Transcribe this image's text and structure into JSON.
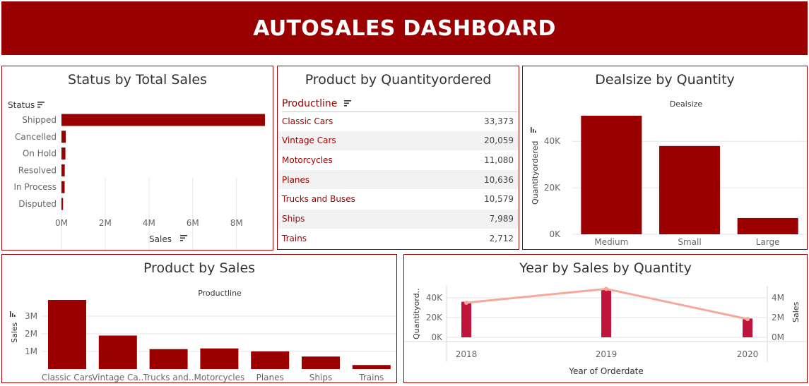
{
  "header": {
    "title": "AUTOSALES DASHBOARD"
  },
  "colors": {
    "brand": "#9a0000",
    "bar": "#9a0000",
    "sales_bar": "#c0143c",
    "line": "#f4a99a",
    "grid": "#e6e6e6"
  },
  "status_panel": {
    "title": "Status by Total Sales",
    "row_header": "Status",
    "axis_label": "Sales",
    "sort_icon": "sort-descending-icon",
    "chart_data": {
      "type": "bar",
      "orientation": "horizontal",
      "categories": [
        "Shipped",
        "Cancelled",
        "On Hold",
        "Resolved",
        "In Process",
        "Disputed"
      ],
      "values": [
        9300000,
        195000,
        180000,
        150000,
        145000,
        72000
      ],
      "xlim": [
        0,
        9300000
      ],
      "ticks": [
        0,
        2000000,
        4000000,
        6000000,
        8000000
      ],
      "tick_labels": [
        "0M",
        "2M",
        "4M",
        "6M",
        "8M"
      ],
      "grid": true
    }
  },
  "quantity_panel": {
    "title": "Product by Quantityordered",
    "row_header": "Productline",
    "sort_icon": "sort-descending-icon",
    "chart_data": {
      "type": "table",
      "rows": [
        {
          "name": "Classic Cars",
          "value": "33,373"
        },
        {
          "name": "Vintage Cars",
          "value": "20,059"
        },
        {
          "name": "Motorcycles",
          "value": "11,080"
        },
        {
          "name": "Planes",
          "value": "10,636"
        },
        {
          "name": "Trucks and Buses",
          "value": "10,579"
        },
        {
          "name": "Ships",
          "value": "7,989"
        },
        {
          "name": "Trains",
          "value": "2,712"
        }
      ]
    }
  },
  "dealsize_panel": {
    "title": "Dealsize by Quantity",
    "column_header": "Dealsize",
    "ylabel": "Quantityordered",
    "chart_data": {
      "type": "bar",
      "categories": [
        "Medium",
        "Small",
        "Large"
      ],
      "values": [
        51000,
        38000,
        7000
      ],
      "ylim": [
        0,
        51000
      ],
      "ticks": [
        0,
        20000,
        40000
      ],
      "tick_labels": [
        "0K",
        "20K",
        "40K"
      ]
    }
  },
  "product_sales_panel": {
    "title": "Product by Sales",
    "column_header": "Productline",
    "ylabel": "Sales",
    "chart_data": {
      "type": "bar",
      "categories": [
        "Classic Cars",
        "Vintage Ca..",
        "Trucks and..",
        "Motorcycles",
        "Planes",
        "Ships",
        "Trains"
      ],
      "values": [
        3920000,
        1900000,
        1130000,
        1170000,
        1000000,
        710000,
        230000
      ],
      "ylim": [
        0,
        4000000
      ],
      "ticks": [
        1000000,
        2000000,
        3000000
      ],
      "tick_labels": [
        "1M",
        "2M",
        "3M"
      ]
    }
  },
  "year_panel": {
    "title": "Year by Sales by Quantity",
    "xlabel": "Year of Orderdate",
    "ylabel_left": "Quantityord..",
    "ylabel_right": "Sales",
    "chart_data": {
      "type": "bar",
      "categories": [
        "2018",
        "2019",
        "2020"
      ],
      "series": [
        {
          "name": "Quantityordered",
          "type": "bar",
          "values": [
            36000,
            49000,
            19000
          ]
        },
        {
          "name": "Sales",
          "type": "line",
          "values": [
            3500000,
            4900000,
            1850000
          ]
        }
      ],
      "ylim_left": [
        0,
        50000
      ],
      "ticks_left": [
        0,
        20000,
        40000
      ],
      "tick_labels_left": [
        "0K",
        "20K",
        "40K"
      ],
      "ylim_right": [
        0,
        5000000
      ],
      "ticks_right": [
        0,
        2000000,
        4000000
      ],
      "tick_labels_right": [
        "0M",
        "2M",
        "4M"
      ]
    }
  }
}
